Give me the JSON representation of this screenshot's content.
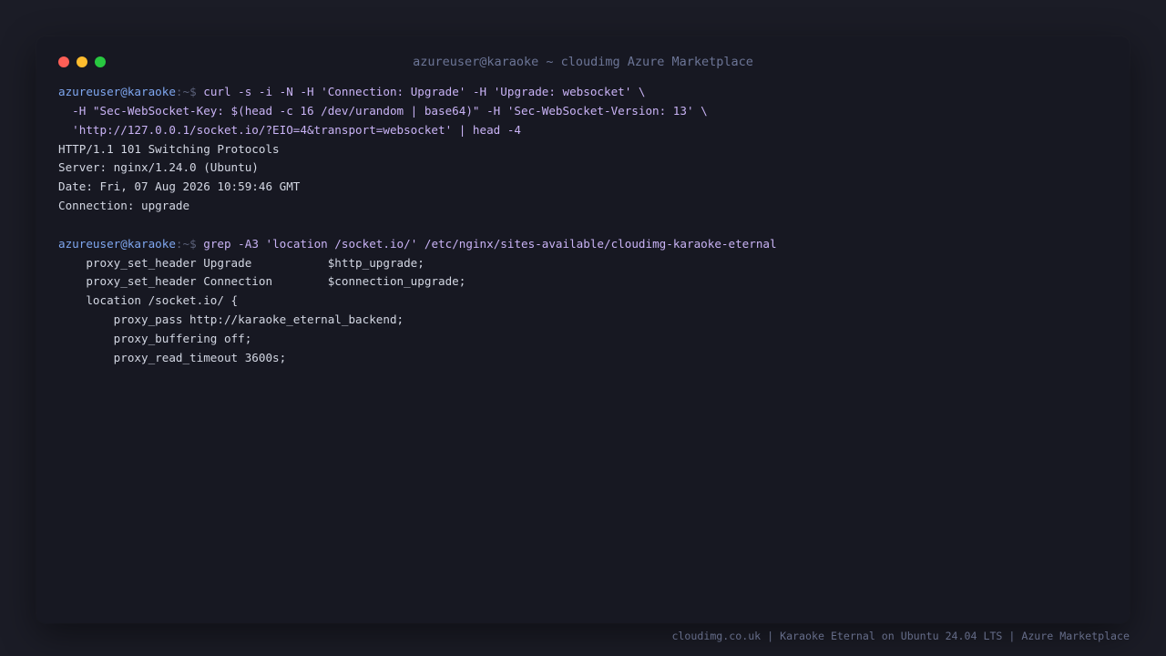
{
  "window": {
    "title": "azureuser@karaoke ~ cloudimg Azure Marketplace",
    "controls": {
      "close_color": "#ff5f57",
      "minimize_color": "#febc2e",
      "maximize_color": "#28c840"
    }
  },
  "terminal": {
    "prompt": {
      "user_host": "azureuser@karaoke",
      "path": ":~$ "
    },
    "command1": {
      "line1": "curl -s -i -N -H 'Connection: Upgrade' -H 'Upgrade: websocket' \\",
      "line2": "  -H \"Sec-WebSocket-Key: $(head -c 16 /dev/urandom | base64)\" -H 'Sec-WebSocket-Version: 13' \\",
      "line3": "  'http://127.0.0.1/socket.io/?EIO=4&transport=websocket' | head -4"
    },
    "output1": [
      "HTTP/1.1 101 Switching Protocols",
      "Server: nginx/1.24.0 (Ubuntu)",
      "Date: Fri, 07 Aug 2026 10:59:46 GMT",
      "Connection: upgrade"
    ],
    "command2": {
      "line1": "grep -A3 'location /socket.io/' /etc/nginx/sites-available/cloudimg-karaoke-eternal"
    },
    "output2": [
      "    proxy_set_header Upgrade           $http_upgrade;",
      "    proxy_set_header Connection        $connection_upgrade;",
      "    location /socket.io/ {",
      "        proxy_pass http://karaoke_eternal_backend;",
      "        proxy_buffering off;",
      "        proxy_read_timeout 3600s;"
    ]
  },
  "footer": {
    "text": "cloudimg.co.uk | Karaoke Eternal on Ubuntu 24.04 LTS | Azure Marketplace"
  },
  "colors": {
    "background": "#1b1c26",
    "window": "#171822",
    "prompt_user": "#7fa7f0",
    "command": "#c9b3f5",
    "output": "#d3d7e3"
  }
}
